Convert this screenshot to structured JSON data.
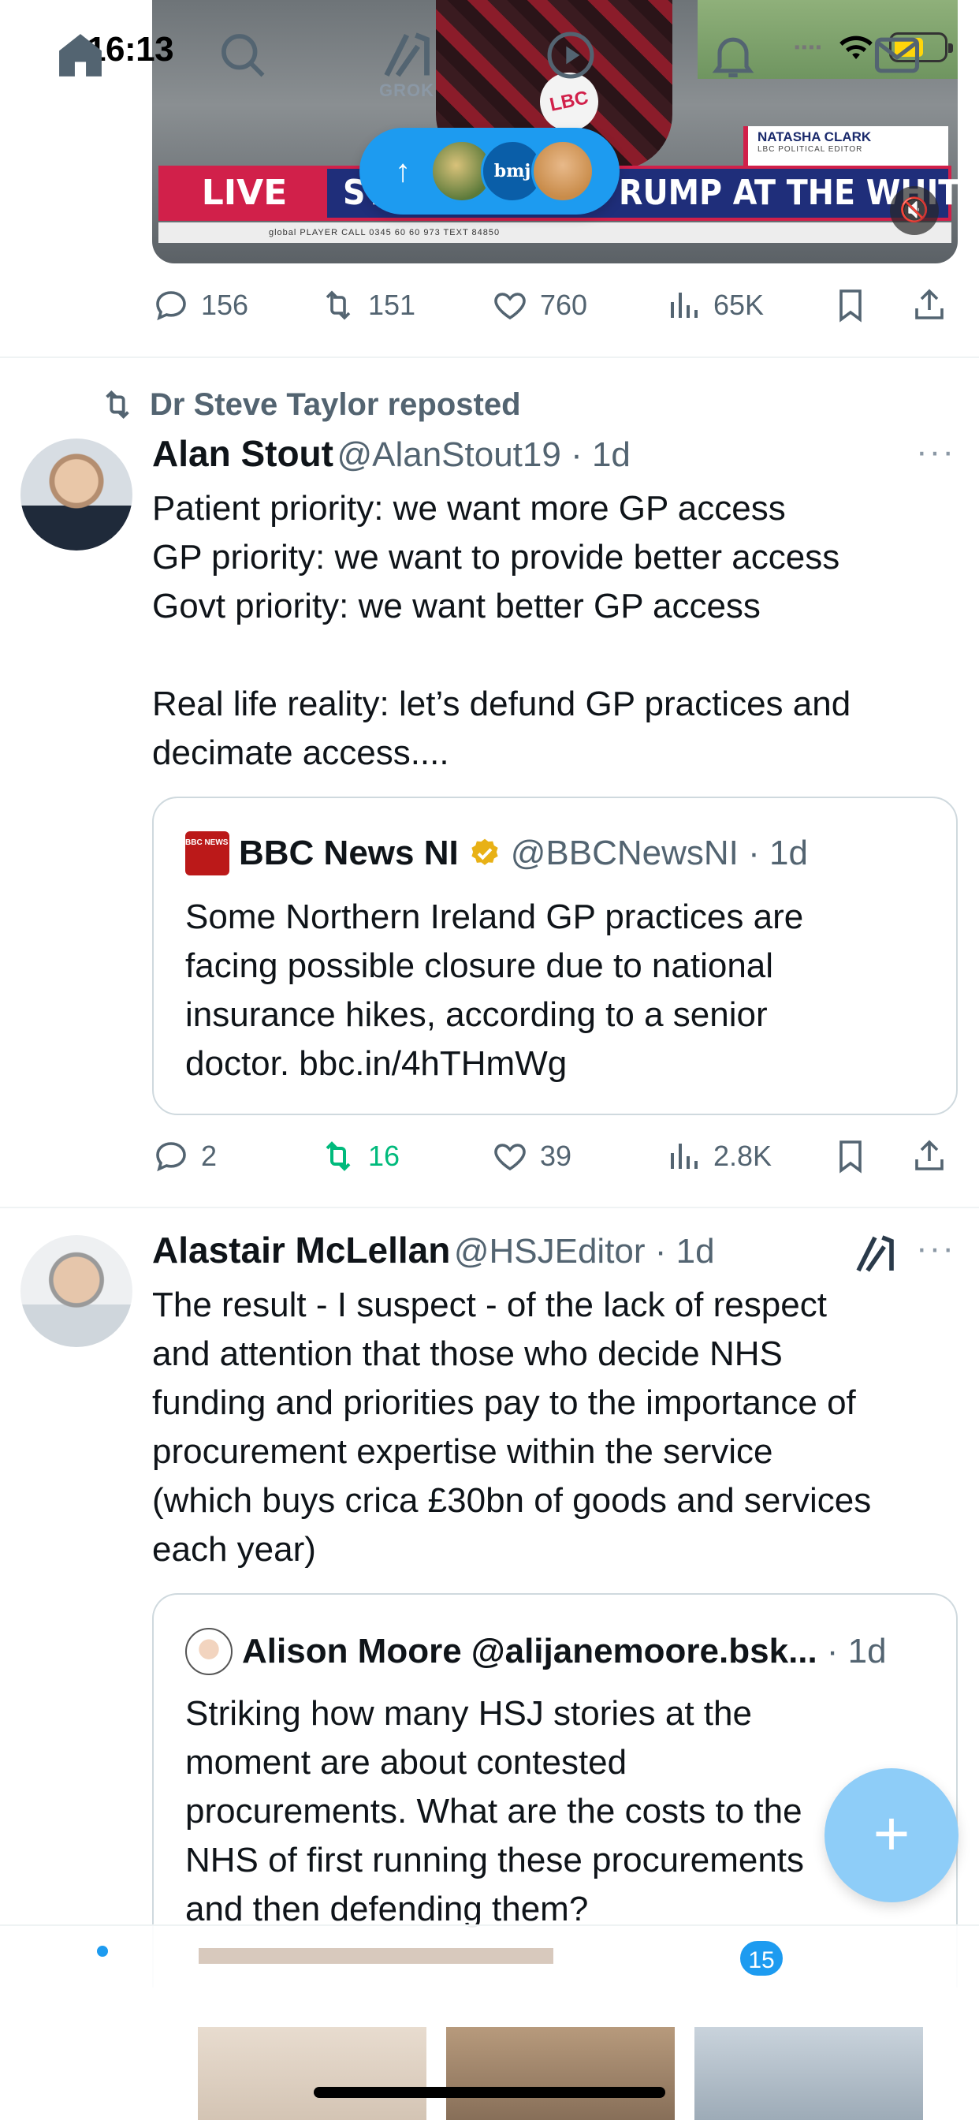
{
  "status_bar": {
    "time": "16:13"
  },
  "video": {
    "live_label": "LIVE",
    "headline": "ST▮▮▮▮▮▮▮▮▮RUMP AT THE WHITE HOUSE",
    "headline_left": "STA",
    "headline_right": "RUMP AT THE WHITE HOUSE",
    "mic_label": "LBC",
    "reporter_name": "NATASHA CLARK",
    "reporter_role": "LBC POLITICAL EDITOR",
    "strap_text": "global PLAYER   CALL 0345 60 60 973   TEXT 84850"
  },
  "new_posts_pill": {
    "arrow": "↑",
    "avatar_label": "bmj"
  },
  "post_1_actions": {
    "replies": "156",
    "reposts": "151",
    "likes": "760",
    "views": "65K"
  },
  "post_2": {
    "repost_label": "Dr Steve Taylor reposted",
    "name": "Alan Stout",
    "handle_time": "@AlanStout19 · 1d",
    "text": "Patient priority: we want more GP access\nGP priority: we want to provide better access\nGovt priority: we want better GP access\n\nReal life reality: let’s defund GP practices and\ndecimate access....",
    "quote": {
      "logo_label": "BBC NEWS NI",
      "name": "BBC News NI",
      "handle_time": "@BBCNewsNI · 1d",
      "text": "Some Northern Ireland GP practices are\nfacing possible closure due to national\ninsurance hikes, according to a senior\ndoctor. bbc.in/4hTHmWg"
    },
    "actions": {
      "replies": "2",
      "reposts": "16",
      "likes": "39",
      "views": "2.8K"
    }
  },
  "post_3": {
    "name": "Alastair McLellan",
    "handle_time": "@HSJEditor · 1d",
    "text": "The result - I suspect - of the lack of respect\nand attention that those who decide NHS\nfunding and priorities pay to the importance of\nprocurement expertise within the service\n(which buys crica £30bn of goods and services\neach year)",
    "quote": {
      "name": "Alison Moore",
      "handle": "@alijanemoore.bsk...",
      "time": "· 1d",
      "text": "Striking how many HSJ stories at the\nmoment are about contested\nprocurements. What are the costs to the\nNHS of first running these procurements\nand then defending them?"
    }
  },
  "more_label": "···",
  "fab_label": "+",
  "tabbar": {
    "grok_label": "GROK",
    "notifications_badge": "15"
  },
  "colors": {
    "accent": "#1d9bf0",
    "repost_green": "#00ba7c",
    "muted": "#536471",
    "gold": "#e8b116"
  }
}
